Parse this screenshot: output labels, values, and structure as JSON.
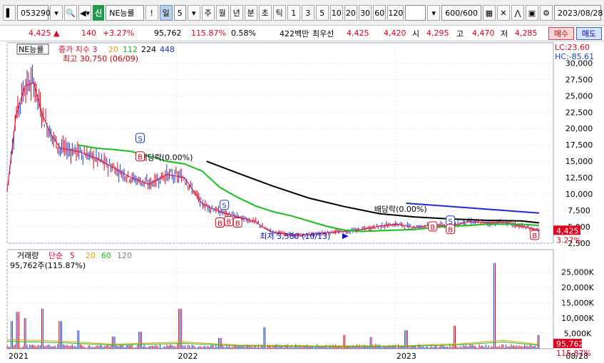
{
  "toolbar": {
    "code": "053290",
    "badge": "신",
    "name": "NE능률",
    "period_tabs": [
      "일",
      "주",
      "월",
      "년",
      "분",
      "초",
      "틱"
    ],
    "period_value": "5",
    "interval_buttons": [
      "1",
      "3",
      "5",
      "10",
      "20",
      "30",
      "60",
      "120"
    ],
    "count": "600/600",
    "date": "2023/08/28"
  },
  "quote": {
    "price": "4,425",
    "change": "140",
    "change_pct": "+3.27%",
    "volume": "95,762",
    "volume_ratio": "115.87%",
    "turnover": "0.58%",
    "amount": "422백만",
    "best_label": "최우선",
    "ask": "4,425",
    "bid": "4,420",
    "open_label": "시",
    "open": "4,295",
    "high_label": "고",
    "high": "4,470",
    "low_label": "저",
    "low": "4,285",
    "buy": "매수",
    "sell": "매도"
  },
  "colors": {
    "up": "#e0001b",
    "down": "#1a3fd0",
    "ma5": "#e8002a",
    "ma20": "#e8a000",
    "ma112": "#18c018",
    "ma224": "#000000",
    "ma448": "#1a2ad8"
  },
  "chart_data": [
    {
      "type": "line",
      "title": "NE능률",
      "legend_prefix": "종가 지수",
      "series": [
        {
          "name": "3",
          "color": "#e8002a",
          "x": [
            0,
            10,
            20,
            30,
            40,
            50,
            60,
            80,
            100,
            120,
            140,
            160,
            180,
            200,
            220,
            240,
            260,
            280,
            290,
            300,
            310,
            320,
            330,
            340,
            360,
            380,
            400,
            420,
            440,
            460,
            480,
            500,
            520,
            540,
            560,
            580,
            600
          ],
          "values": [
            10500,
            22000,
            26500,
            27000,
            22000,
            19000,
            17000,
            16500,
            15500,
            14000,
            12500,
            11500,
            13000,
            12500,
            8500,
            7300,
            6500,
            5800,
            4800,
            4200,
            4000,
            3800,
            3700,
            3800,
            4100,
            4300,
            4600,
            5100,
            5400,
            4900,
            5300,
            5100,
            5800,
            5600,
            5700,
            5100,
            4425
          ]
        },
        {
          "name": "112",
          "color": "#18c018",
          "x": [
            80,
            100,
            120,
            140,
            160,
            180,
            200,
            220,
            240,
            260,
            280,
            300,
            320,
            340,
            360,
            380,
            400,
            420,
            440,
            460,
            480,
            500,
            520,
            540,
            560,
            580,
            600
          ],
          "values": [
            17500,
            17000,
            16800,
            16500,
            15800,
            15000,
            14600,
            13500,
            11000,
            9500,
            8200,
            7300,
            6700,
            5900,
            5100,
            4500,
            4300,
            4400,
            4500,
            4600,
            4900,
            5100,
            5200,
            5400,
            5400,
            5400,
            5200
          ]
        },
        {
          "name": "224",
          "color": "#000000",
          "x": [
            225,
            260,
            300,
            340,
            380,
            420,
            460,
            500,
            540,
            580,
            600
          ],
          "values": [
            15000,
            13200,
            11200,
            9400,
            8100,
            7000,
            6500,
            6200,
            6000,
            5900,
            5600
          ]
        },
        {
          "name": "448",
          "color": "#1a2ad8",
          "x": [
            450,
            500,
            550,
            600
          ],
          "values": [
            8600,
            8100,
            7600,
            7100
          ]
        }
      ],
      "ylim": [
        2500,
        32000
      ],
      "yticks": [
        "2,500",
        "5,000",
        "7,500",
        "10,000",
        "12,500",
        "15,000",
        "17,500",
        "20,000",
        "22,500",
        "25,000",
        "27,500",
        "30,000"
      ],
      "xticks": [
        "2021",
        "2022",
        "2023",
        "08/28"
      ],
      "annotations": {
        "high": "최고 30,750 (06/09)",
        "low": "최저 3,580 (10/13)",
        "dividend": "배당락(0.00%)",
        "lc": "LC:23.60",
        "hc": "HC:-85.61",
        "last": "4,425",
        "last_pct": "3.27%"
      }
    },
    {
      "type": "bar",
      "title": "거래량",
      "legend_prefix": "단순",
      "legend_items": [
        {
          "label": "5",
          "color": "#e8002a"
        },
        {
          "label": "20",
          "color": "#e8a000"
        },
        {
          "label": "60",
          "color": "#18c018"
        },
        {
          "label": "120",
          "color": "#808080"
        }
      ],
      "current": "95,762주(115.87%)",
      "spikes_x": [
        5,
        12,
        20,
        40,
        60,
        80,
        120,
        150,
        195,
        240,
        290,
        380,
        410,
        450,
        505,
        550,
        600
      ],
      "spikes_values": [
        9000,
        12000,
        10000,
        13000,
        9000,
        6000,
        4000,
        5500,
        13000,
        3500,
        7000,
        4500,
        3800,
        6000,
        7500,
        28000,
        4500
      ],
      "ylim": [
        0,
        30000
      ],
      "yticks": [
        "5,000K",
        "10,000K",
        "15,000K",
        "20,000K",
        "25,000K"
      ],
      "last": "95,762",
      "last_pct": "115.87%"
    }
  ]
}
